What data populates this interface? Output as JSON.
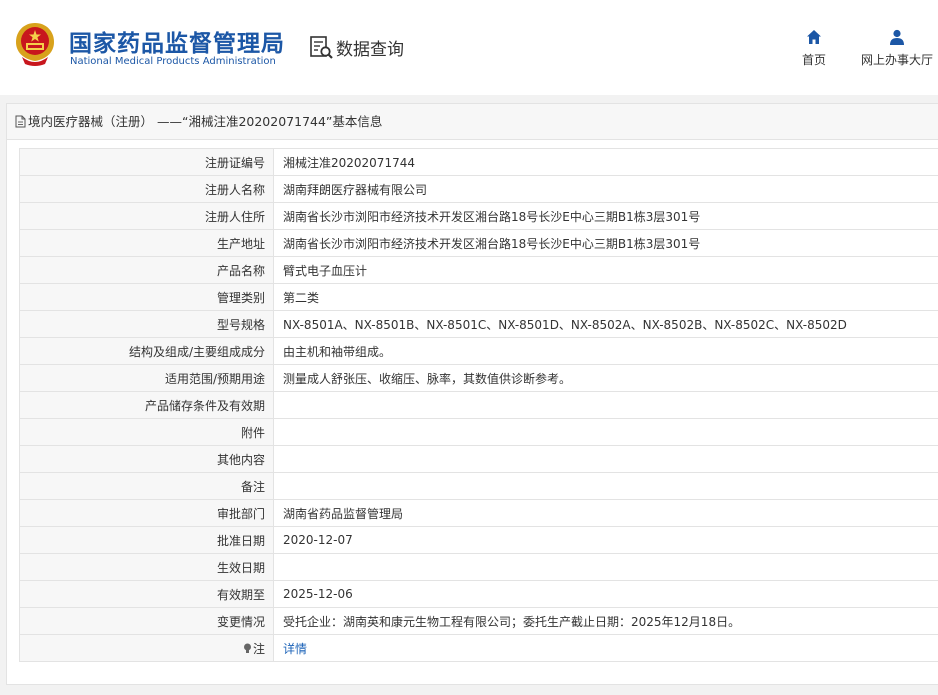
{
  "header": {
    "brand_cn": "国家药品监督管理局",
    "brand_en": "National Medical Products Administration",
    "query_label": "数据查询",
    "nav": [
      {
        "label": "首页",
        "icon": "home-icon"
      },
      {
        "label": "网上办事大厅",
        "icon": "user-icon"
      }
    ]
  },
  "card": {
    "title": "境内医疗器械（注册） ——“湘械注准20202071744”基本信息"
  },
  "rows": [
    {
      "label": "注册证编号",
      "value": "湘械注准20202071744"
    },
    {
      "label": "注册人名称",
      "value": "湖南拜朗医疗器械有限公司"
    },
    {
      "label": "注册人住所",
      "value": "湖南省长沙市浏阳市经济技术开发区湘台路18号长沙E中心三期B1栋3层301号"
    },
    {
      "label": "生产地址",
      "value": "湖南省长沙市浏阳市经济技术开发区湘台路18号长沙E中心三期B1栋3层301号"
    },
    {
      "label": "产品名称",
      "value": "臂式电子血压计"
    },
    {
      "label": "管理类别",
      "value": "第二类"
    },
    {
      "label": "型号规格",
      "value": "NX-8501A、NX-8501B、NX-8501C、NX-8501D、NX-8502A、NX-8502B、NX-8502C、NX-8502D"
    },
    {
      "label": "结构及组成/主要组成成分",
      "value": "由主机和袖带组成。"
    },
    {
      "label": "适用范围/预期用途",
      "value": "测量成人舒张压、收缩压、脉率，其数值供诊断参考。"
    },
    {
      "label": "产品储存条件及有效期",
      "value": ""
    },
    {
      "label": "附件",
      "value": ""
    },
    {
      "label": "其他内容",
      "value": ""
    },
    {
      "label": "备注",
      "value": ""
    },
    {
      "label": "审批部门",
      "value": "湖南省药品监督管理局"
    },
    {
      "label": "批准日期",
      "value": "2020-12-07"
    },
    {
      "label": "生效日期",
      "value": ""
    },
    {
      "label": "有效期至",
      "value": "2025-12-06"
    },
    {
      "label": "变更情况",
      "value": "受托企业：湖南英和康元生物工程有限公司；委托生产截止日期：2025年12月18日。"
    }
  ],
  "note_row": {
    "label": "注",
    "link": "详情",
    "icon": "lightbulb-icon"
  },
  "colors": {
    "brand": "#1c57a6",
    "link": "#1c63b8",
    "label_bg": "#f7f7f7",
    "border": "#e3e3e3"
  }
}
